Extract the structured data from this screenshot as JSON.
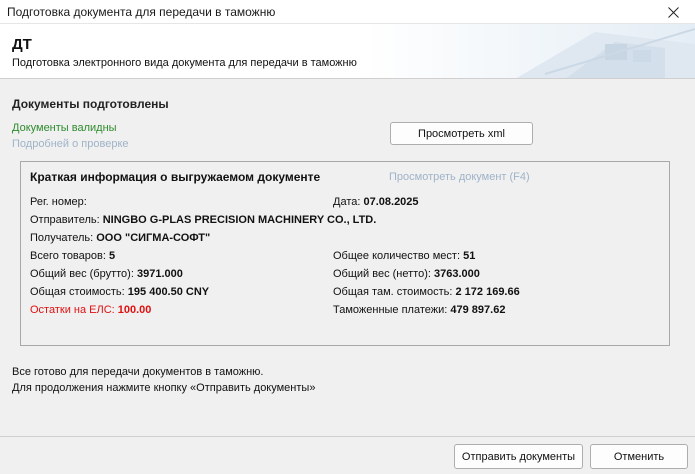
{
  "window": {
    "title": "Подготовка документа для передачи в таможню"
  },
  "header": {
    "title": "ДТ",
    "subtitle": "Подготовка электронного вида документа для передачи в таможню"
  },
  "status": {
    "heading": "Документы подготовлены",
    "valid": "Документы валидны",
    "details_link": "Подробней о проверке",
    "view_xml_button": "Просмотреть xml"
  },
  "info": {
    "title": "Краткая информация о выгружаемом документе",
    "preview_link": "Просмотреть документ (F4)",
    "reg_label": "Рег. номер:",
    "date_label": "Дата:",
    "date_value": "07.08.2025",
    "sender_label": "Отправитель:",
    "sender_value": "NINGBO G-PLAS PRECISION MACHINERY CO., LTD.",
    "receiver_label": "Получатель:",
    "receiver_value": "ООО \"СИГМА-СОФТ\"",
    "goods_label": "Всего товаров:",
    "goods_value": "5",
    "places_label": "Общее количество мест:",
    "places_value": "51",
    "gross_label": "Общий вес (брутто):",
    "gross_value": "3971.000",
    "net_label": "Общий вес (нетто):",
    "net_value": "3763.000",
    "cost_label": "Общая стоимость:",
    "cost_value": "195 400.50 CNY",
    "customs_cost_label": "Общая там. стоимость:",
    "customs_cost_value": "2 172 169.66",
    "els_label": "Остатки на ЕЛС:",
    "els_value": "100.00",
    "payments_label": "Таможенные платежи:",
    "payments_value": "479 897.62"
  },
  "bottom": {
    "line1": "Все готово для передачи документов в таможню.",
    "line2": "Для продолжения нажмите кнопку «Отправить документы»"
  },
  "footer": {
    "send_button": "Отправить документы",
    "cancel_button": "Отменить"
  },
  "colors": {
    "valid_green": "#2e8b2e",
    "link_disabled": "#9fb3c8",
    "warning_red": "#e01010"
  },
  "icons": {
    "close": "close-icon"
  }
}
